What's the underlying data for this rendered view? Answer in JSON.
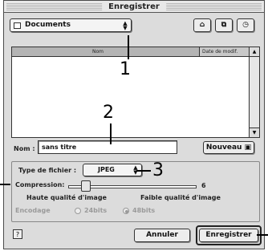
{
  "window": {
    "title": "Enregistrer"
  },
  "location_popup": {
    "value": "Documents"
  },
  "file_list": {
    "columns": [
      "Nom",
      "Date de modif."
    ],
    "items": []
  },
  "name_field": {
    "label": "Nom :",
    "value": "sans titre"
  },
  "new_button": {
    "label": "Nouveau"
  },
  "options": {
    "file_type_label": "Type de fichier :",
    "file_type_value": "JPEG",
    "compression_label": "Compression:",
    "compression_value": "6",
    "high_quality_label": "Haute qualité d'image",
    "low_quality_label": "Faible qualité d'image",
    "encoding_label": "Encodage",
    "encoding_options": [
      "24bits",
      "48bits"
    ],
    "encoding_selected": "48bits"
  },
  "buttons": {
    "cancel": "Annuler",
    "save": "Enregistrer"
  },
  "callouts": [
    "1",
    "2",
    "3"
  ],
  "colors": {
    "chrome": "#dcdcdc",
    "list_header": "#c8c8c8",
    "border": "#333333"
  }
}
